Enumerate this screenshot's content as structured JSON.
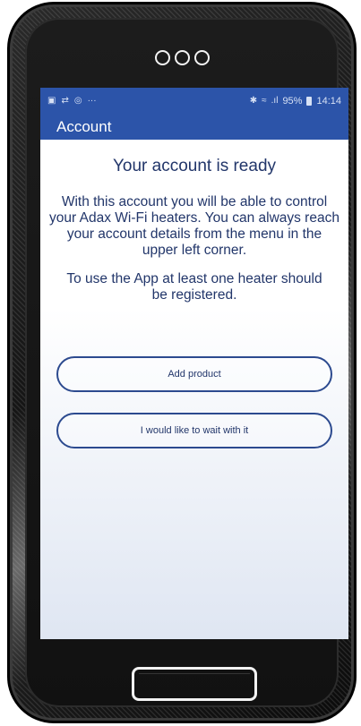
{
  "status_bar": {
    "left_icons": [
      "gallery-icon",
      "sync-icon",
      "instagram-icon",
      "more-icon"
    ],
    "more_text": "···",
    "bluetooth": "✱",
    "wifi": "≈",
    "signal": ".ıl",
    "battery_percent": "95%",
    "time": "14:14"
  },
  "app_bar": {
    "title": "Account"
  },
  "main": {
    "heading": "Your account is ready",
    "paragraph1": "With this account you will be able to control your Adax Wi-Fi heaters. You can always reach your account details from the menu in the upper left corner.",
    "paragraph2": "To use the App at least one heater should be registered.",
    "add_product_label": "Add product",
    "wait_label": "I would like to wait with it"
  },
  "colors": {
    "app_bar": "#2c54a9",
    "text": "#22366a",
    "button_border": "#2c4a8f"
  }
}
